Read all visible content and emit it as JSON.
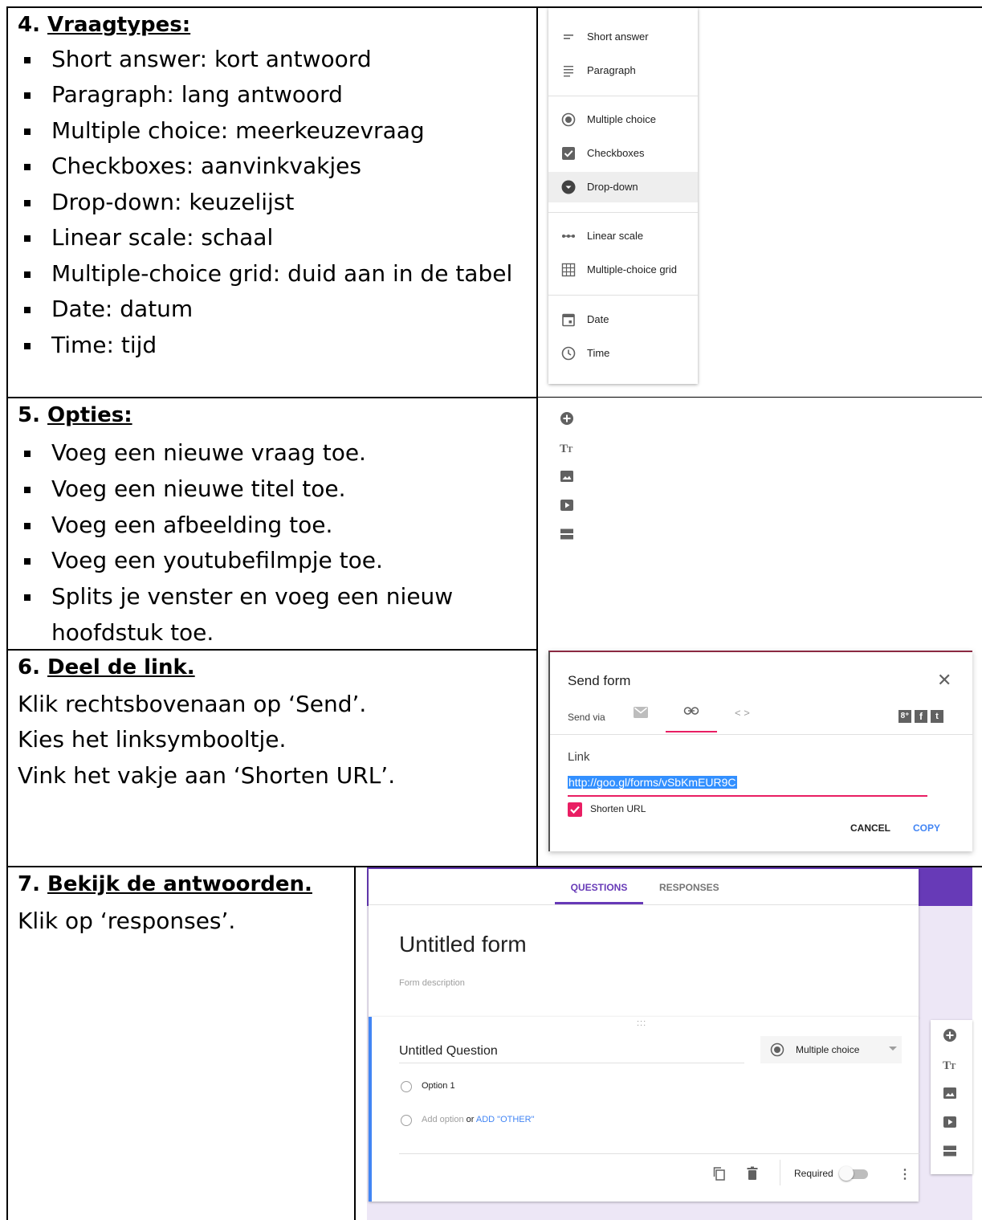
{
  "section4": {
    "number": "4.",
    "title": "Vraagtypes:",
    "items": [
      "Short answer: kort antwoord",
      "Paragraph: lang antwoord",
      "Multiple choice: meerkeuzevraag",
      "Checkboxes: aanvinkvakjes",
      "Drop-down: keuzelijst",
      "Linear scale: schaal",
      "Multiple-choice grid: duid aan in de tabel",
      "Date: datum",
      "Time: tijd"
    ]
  },
  "menu": {
    "items": [
      {
        "label": "Short answer",
        "icon": "short-answer-icon"
      },
      {
        "label": "Paragraph",
        "icon": "paragraph-icon"
      },
      {
        "label": "Multiple choice",
        "icon": "radio-icon"
      },
      {
        "label": "Checkboxes",
        "icon": "checkbox-icon"
      },
      {
        "label": "Drop-down",
        "icon": "dropdown-icon"
      },
      {
        "label": "Linear scale",
        "icon": "linear-scale-icon"
      },
      {
        "label": "Multiple-choice grid",
        "icon": "grid-icon"
      },
      {
        "label": "Date",
        "icon": "calendar-icon"
      },
      {
        "label": "Time",
        "icon": "clock-icon"
      }
    ]
  },
  "section5": {
    "number": "5.",
    "title": "Opties:",
    "items": [
      "Voeg een nieuwe vraag toe.",
      "Voeg een nieuwe titel toe.",
      "Voeg een afbeelding toe.",
      "Voeg een youtubefilmpje toe.",
      "Splits je venster en voeg een nieuw",
      "hoofdstuk toe."
    ]
  },
  "section6": {
    "number": "6.",
    "title": "Deel de link.",
    "lines": [
      "Klik rechtsbovenaan op ‘Send’.",
      "Kies het linksymbooltje.",
      "Vink het vakje aan ‘Shorten URL’."
    ]
  },
  "send_dialog": {
    "title": "Send form",
    "send_via": "Send via",
    "link_label": "Link",
    "url": "http://goo.gl/forms/vSbKmEUR9C",
    "shorten": "Shorten URL",
    "cancel": "CANCEL",
    "copy": "COPY",
    "accent": "#e91e63",
    "copy_color": "#4285f4"
  },
  "section7": {
    "number": "7.",
    "title": "Bekijk de antwoorden.",
    "line": "Klik op ‘responses’."
  },
  "form": {
    "tab_questions": "QUESTIONS",
    "tab_responses": "RESPONSES",
    "title": "Untitled form",
    "description": "Form description",
    "question": "Untitled Question",
    "question_type": "Multiple choice",
    "option1": "Option 1",
    "add_option": "Add option",
    "or": "or",
    "add_other": "ADD \"OTHER\"",
    "required": "Required",
    "theme": "#673ab7",
    "drag": ":::"
  }
}
